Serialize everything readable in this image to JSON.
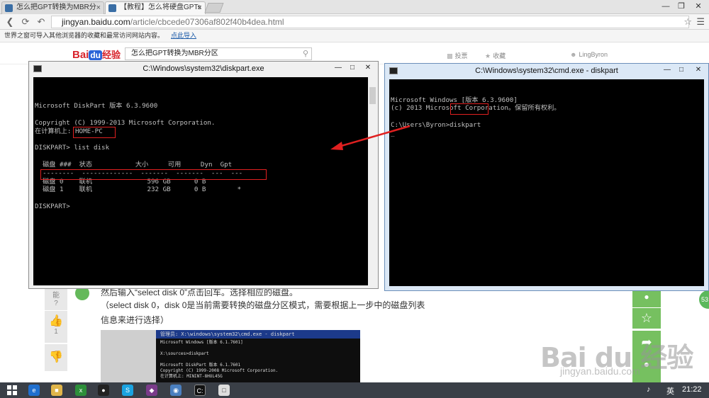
{
  "tabs": [
    {
      "title": "怎么把GPT转换为MBR分",
      "close": "×"
    },
    {
      "title": "【教程】怎么将硬盘GPTs",
      "close": "×"
    }
  ],
  "window_controls": {
    "minimize": "—",
    "restore": "❐",
    "close": "✕"
  },
  "url": {
    "host": "jingyan.baidu.com",
    "path": "/article/cbcede07306af802f40b4dea.html"
  },
  "bookmark_bar": {
    "text": "世界之窗可导入其他浏览器的收藏和最常访问网站内容。",
    "link": "点此导入"
  },
  "site": {
    "logo_text": "Bai",
    "logo_du": "du",
    "logo_jy": "经验",
    "search_value": "怎么把GPT转换为MBR分区",
    "vote_label": "投票",
    "fav_label": "收藏",
    "user_name": "LingByron"
  },
  "article": {
    "line1": "然后输入“select disk 0”点击回车。选择相应的磁盘。",
    "line2": "（select disk 0，disk 0是当前需要转换的磁盘分区模式，需要根据上一步中的磁盘列表",
    "line3": "信息来进行选择）",
    "vote_up_count": "1"
  },
  "diskpart_window": {
    "title": "C:\\Windows\\system32\\diskpart.exe",
    "lines": [
      "",
      "Microsoft DiskPart 版本 6.3.9600",
      "",
      "Copyright (C) 1999-2013 Microsoft Corporation.",
      "在计算机上: HOME-PC",
      "",
      "DISKPART> list disk",
      "",
      "  磁盘 ###  状态           大小     可用     Dyn  Gpt",
      "  --------  -------------  -------  -------  ---  ---",
      "  磁盘 0    联机              596 GB      0 B",
      "  磁盘 1    联机              232 GB      0 B        *",
      "",
      "DISKPART>"
    ]
  },
  "cmd_window": {
    "title": "C:\\Windows\\system32\\cmd.exe - diskpart",
    "lines": [
      "Microsoft Windows [版本 6.3.9600]",
      "(c) 2013 Microsoft Corporation。保留所有权利。",
      "",
      "C:\\Users\\Byron>diskpart",
      "_"
    ]
  },
  "embedded_screenshot": {
    "title": "管理员: X:\\windows\\system32\\cmd.exe - diskpart",
    "lines": [
      "Microsoft Windows [版本 6.1.7601]",
      "",
      "X:\\sources>diskpart",
      "",
      "Microsoft DiskPart 版本 6.1.7601",
      "Copyright (C) 1999-2008 Microsoft Corporation.",
      "在计算机上: MININT-8HUL45G"
    ]
  },
  "watermark": {
    "main": "Bai du 经验",
    "sub": "jingyan.baidu.com"
  },
  "right_badge": "53",
  "taskbar": {
    "tray_lang": "英",
    "clock": "21:22"
  },
  "colors": {
    "console_bg": "#000000",
    "console_text": "#c0c0c0",
    "annotation_red": "#e02020",
    "baidu_green": "#76c060",
    "taskbar_bg": "#3a3f47"
  }
}
